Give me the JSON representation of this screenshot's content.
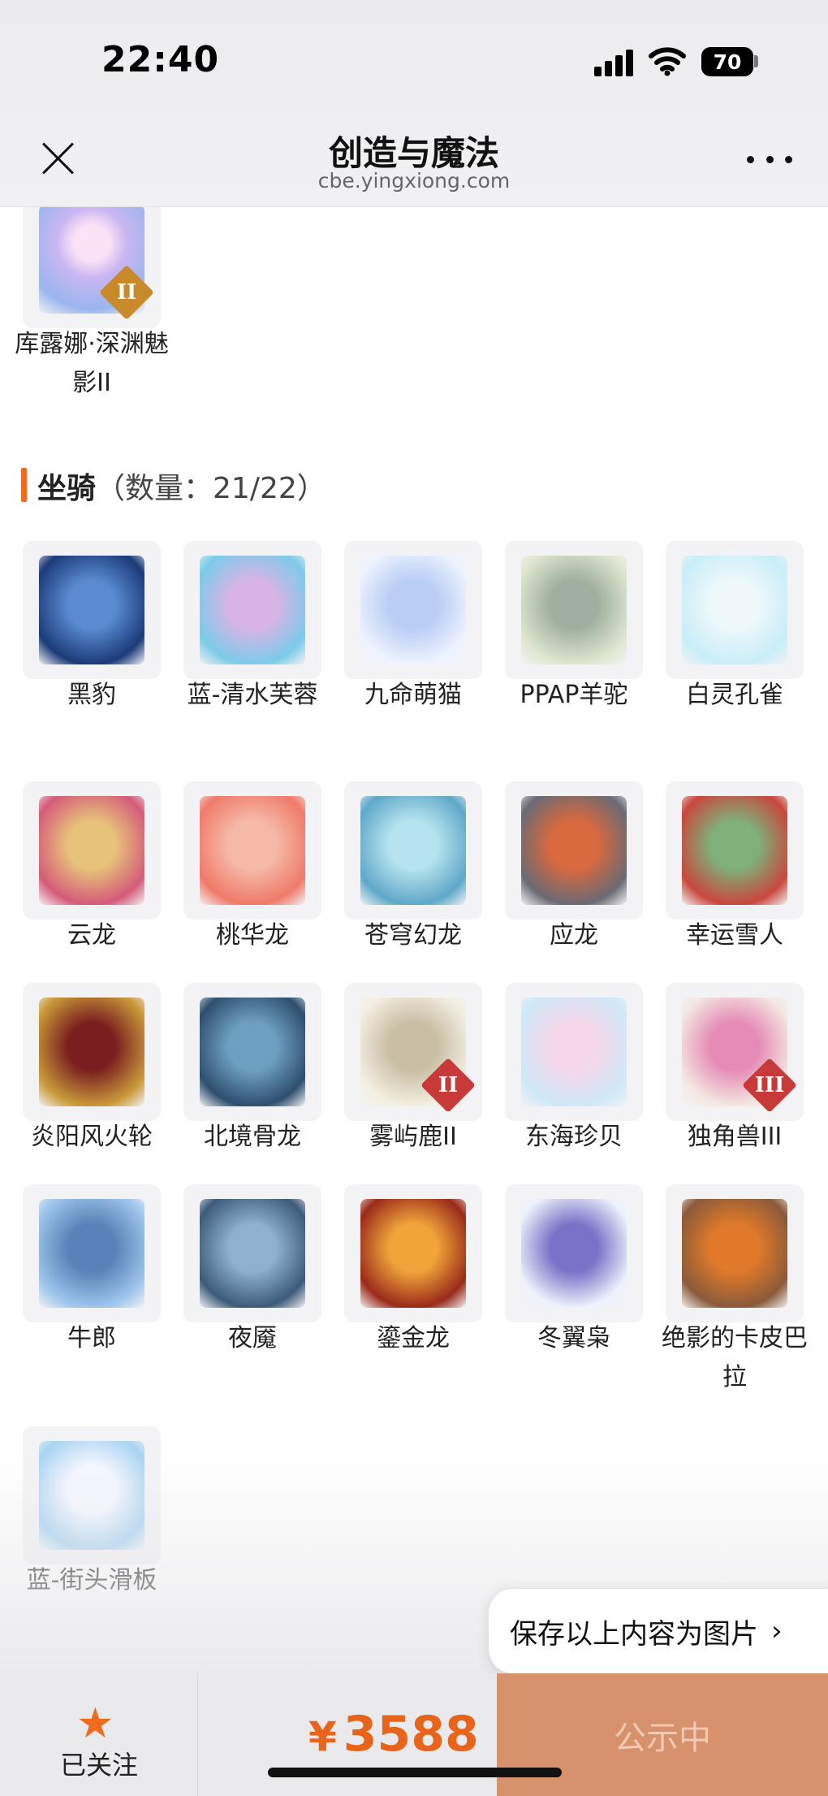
{
  "status_bar": {
    "time": "22:40",
    "battery": "70"
  },
  "header": {
    "title": "创造与魔法",
    "url": "cbe.yingxiong.com"
  },
  "prev_item": {
    "name": "库露娜·深渊魅影II",
    "badge": "II"
  },
  "section": {
    "title": "坐骑",
    "count": "（数量：21/22）"
  },
  "mounts": [
    {
      "name": "黑豹",
      "badge": ""
    },
    {
      "name": "蓝-清水芙蓉",
      "badge": ""
    },
    {
      "name": "九命萌猫",
      "badge": ""
    },
    {
      "name": "PPAP羊驼",
      "badge": ""
    },
    {
      "name": "白灵孔雀",
      "badge": ""
    },
    {
      "name": "云龙",
      "badge": ""
    },
    {
      "name": "桃华龙",
      "badge": ""
    },
    {
      "name": "苍穹幻龙",
      "badge": ""
    },
    {
      "name": "应龙",
      "badge": ""
    },
    {
      "name": "幸运雪人",
      "badge": ""
    },
    {
      "name": "炎阳风火轮",
      "badge": ""
    },
    {
      "name": "北境骨龙",
      "badge": ""
    },
    {
      "name": "雾屿鹿II",
      "badge": "II"
    },
    {
      "name": "东海珍贝",
      "badge": ""
    },
    {
      "name": "独角兽III",
      "badge": "III"
    },
    {
      "name": "牛郎",
      "badge": ""
    },
    {
      "name": "夜魇",
      "badge": ""
    },
    {
      "name": "鎏金龙",
      "badge": ""
    },
    {
      "name": "冬翼枭",
      "badge": ""
    },
    {
      "name": "绝影的卡皮巴拉",
      "badge": ""
    },
    {
      "name": "蓝-街头滑板",
      "badge": ""
    }
  ],
  "save_button": {
    "label": "保存以上内容为图片",
    "chevron": "›"
  },
  "bottom_bar": {
    "follow_label": "已关注",
    "follow_icon": "star-icon",
    "currency": "¥",
    "price": "3588",
    "status_label": "公示中"
  },
  "colors": {
    "accent": "#f26a1b",
    "price": "#e8641b",
    "status_button": "#d7916d"
  }
}
